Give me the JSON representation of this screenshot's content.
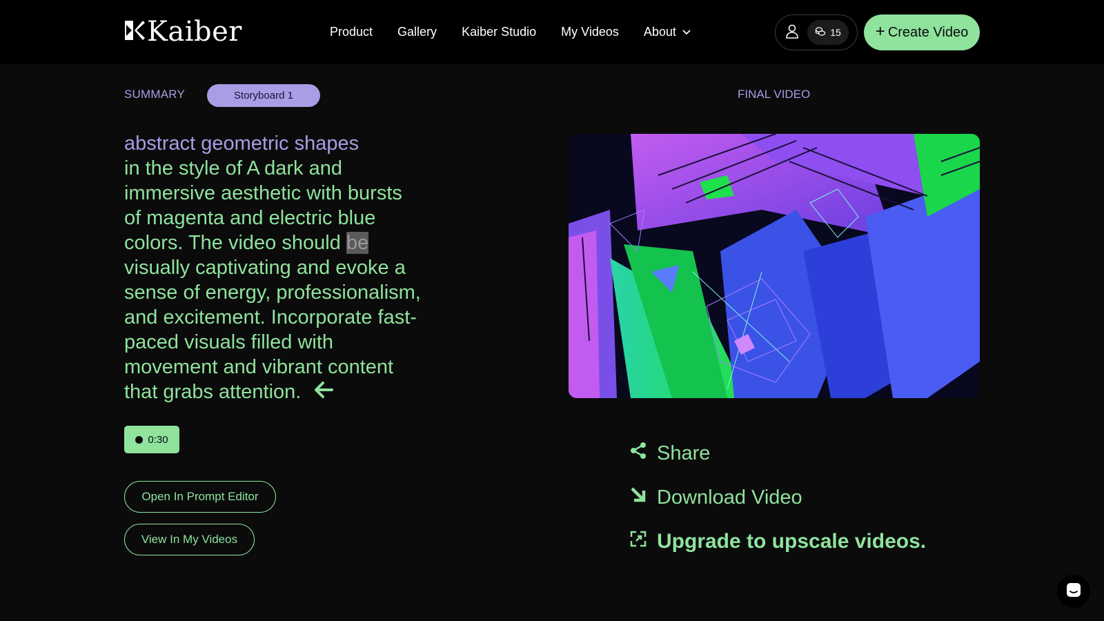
{
  "header": {
    "logo_text": "Kaiber",
    "nav": [
      {
        "label": "Product"
      },
      {
        "label": "Gallery"
      },
      {
        "label": "Kaiber Studio"
      },
      {
        "label": "My Videos"
      },
      {
        "label": "About"
      }
    ],
    "credits": "15",
    "create_button": "Create Video"
  },
  "summary": {
    "label": "SUMMARY",
    "storyboard_tab": "Storyboard 1",
    "prompt_subject": "abstract geometric shapes",
    "prompt_before_highlight": "in the style of A dark and immersive aesthetic with bursts of magenta and electric blue colors. The video should ",
    "prompt_highlight": "be",
    "prompt_after_highlight": " visually captivating and evoke a sense of energy, professionalism, and excitement. Incorporate fast-paced visuals filled with movement and vibrant content that grabs attention.",
    "duration": "0:30",
    "open_editor_button": "Open In Prompt Editor",
    "view_my_videos_button": "View In My Videos"
  },
  "final_video": {
    "label": "FINAL VIDEO",
    "share": "Share",
    "download": "Download Video",
    "upgrade": "Upgrade to upscale videos."
  },
  "colors": {
    "accent_green": "#8fe39d",
    "accent_purple": "#a99de6",
    "background": "#0b0b0b",
    "header_bg": "#000000"
  },
  "icons": [
    "kaiber-logo-icon",
    "chevron-down-icon",
    "user-icon",
    "credits-icon",
    "plus-icon",
    "arrow-left-icon",
    "share-icon",
    "download-arrow-icon",
    "upscale-icon",
    "chat-icon"
  ]
}
